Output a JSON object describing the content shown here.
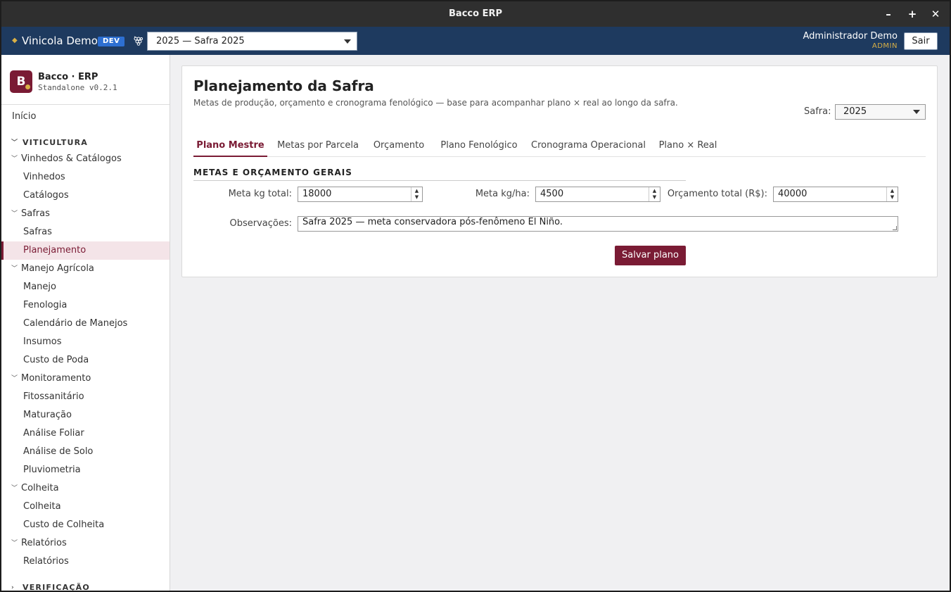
{
  "window": {
    "title": "Bacco ERP",
    "minimize": "–",
    "maximize": "+",
    "close": "✕"
  },
  "header": {
    "org_name": "Vinicola Demo",
    "env_badge": "DEV",
    "safra_selector": "2025 — Safra 2025",
    "user_name": "Administrador Demo",
    "user_role": "ADMIN",
    "logout_label": "Sair",
    "accent_color": "#1e3a5f",
    "gold_color": "#d9b046",
    "grape_icon": "grape-icon"
  },
  "sidebar": {
    "logo_letter": "B",
    "app_name": "Bacco · ERP",
    "app_version": "Standalone v0.2.1",
    "home": "Início",
    "section_viticultura": "VITICULTURA",
    "groups": {
      "vinhedos": "Vinhedos & Catálogos",
      "safras": "Safras",
      "manejo": "Manejo Agrícola",
      "monitoramento": "Monitoramento",
      "colheita": "Colheita",
      "relatorios": "Relatórios"
    },
    "items": {
      "vinhedos": "Vinhedos",
      "catalogos": "Catálogos",
      "safras": "Safras",
      "planejamento": "Planejamento",
      "manejo": "Manejo",
      "fenologia": "Fenologia",
      "calendario": "Calendário de Manejos",
      "insumos": "Insumos",
      "custo_poda": "Custo de Poda",
      "fitossanitario": "Fitossanitário",
      "maturacao": "Maturação",
      "analise_foliar": "Análise Foliar",
      "analise_solo": "Análise de Solo",
      "pluviometria": "Pluviometria",
      "colheita": "Colheita",
      "custo_colheita": "Custo de Colheita",
      "relatorios": "Relatórios"
    },
    "section_verificacao": "VERIFICAÇÃO",
    "active_item": "Planejamento",
    "brand_color": "#7a1b34"
  },
  "main": {
    "title": "Planejamento da Safra",
    "subtitle": "Metas de produção, orçamento e cronograma fenológico — base para acompanhar plano × real ao longo da safra.",
    "safra_filter_label": "Safra:",
    "safra_filter_value": "2025",
    "tabs": [
      "Plano Mestre",
      "Metas por Parcela",
      "Orçamento",
      "Plano Fenológico",
      "Cronograma Operacional",
      "Plano × Real"
    ],
    "active_tab": "Plano Mestre",
    "section_title": "METAS E ORÇAMENTO GERAIS",
    "fields": {
      "meta_kg_total_label": "Meta kg total:",
      "meta_kg_total_value": "18000",
      "meta_kg_ha_label": "Meta kg/ha:",
      "meta_kg_ha_value": "4500",
      "orcamento_label": "Orçamento total (R$):",
      "orcamento_value": "40000",
      "observacoes_label": "Observações:",
      "observacoes_value": "Safra 2025 — meta conservadora pós-fenômeno El Niño."
    },
    "save_label": "Salvar plano"
  }
}
